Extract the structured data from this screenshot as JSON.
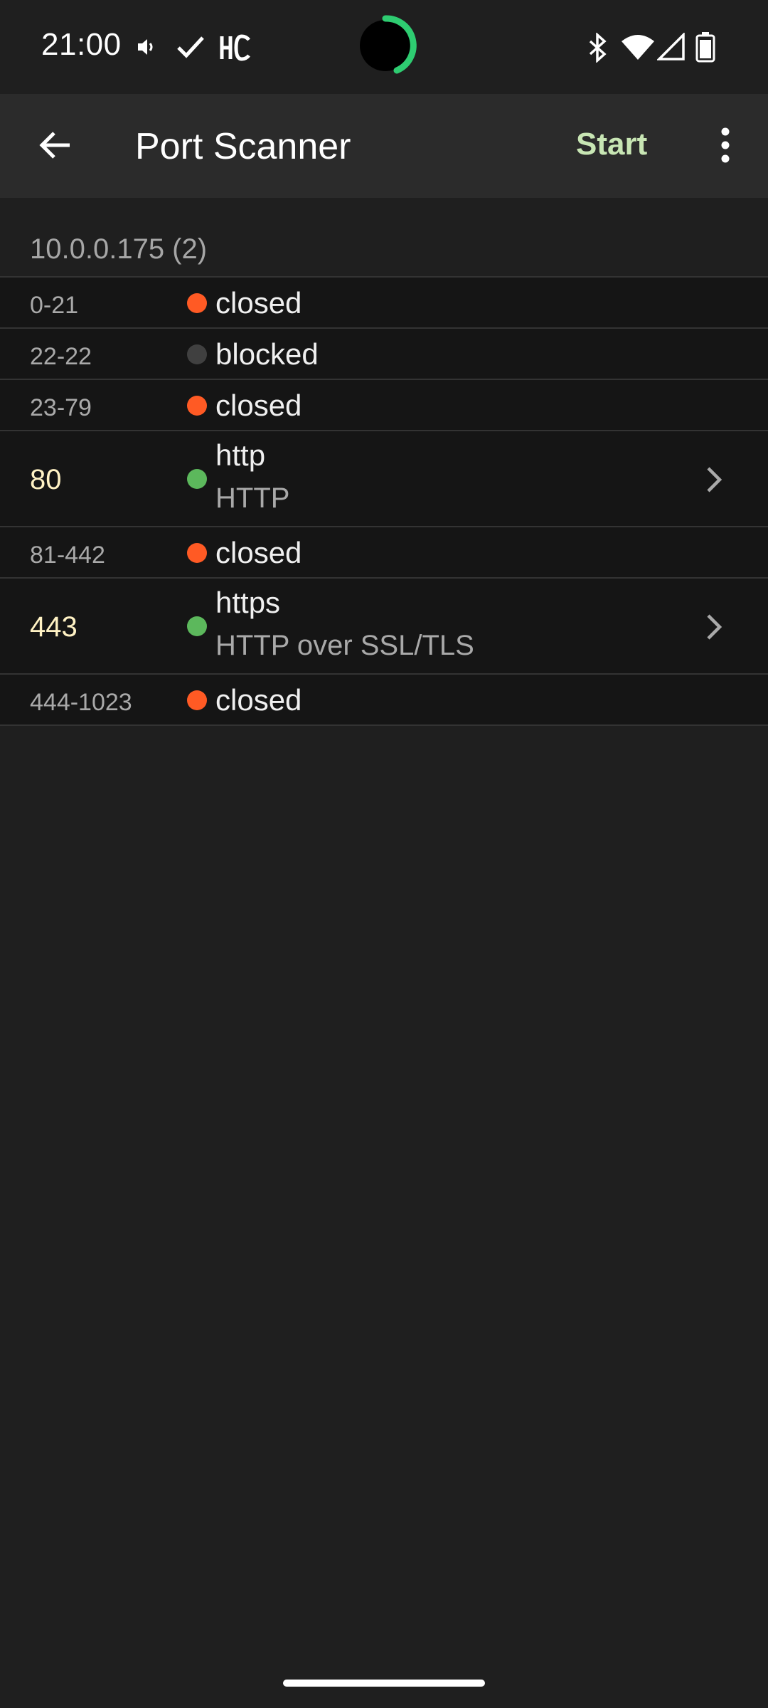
{
  "status_bar": {
    "time": "21:00",
    "icons": [
      "volume-icon",
      "check-icon",
      "hc-icon",
      "bluetooth-icon",
      "wifi-icon",
      "signal-icon",
      "battery-icon"
    ],
    "progress_ring_color": "#2ecc71"
  },
  "app_bar": {
    "title": "Port Scanner",
    "start_label": "Start",
    "start_color": "#c8e6b4",
    "back_icon": "arrow-back-icon",
    "menu_icon": "more-vert-icon"
  },
  "host": {
    "label": "10.0.0.175 (2)"
  },
  "status_colors": {
    "closed": "#ff5a24",
    "blocked": "#404040",
    "open": "#5cb85c"
  },
  "ports": [
    {
      "range": "0-21",
      "state": "closed",
      "status": "closed"
    },
    {
      "range": "22-22",
      "state": "blocked",
      "status": "blocked"
    },
    {
      "range": "23-79",
      "state": "closed",
      "status": "closed"
    },
    {
      "range": "80",
      "state": "http",
      "desc": "HTTP",
      "status": "open"
    },
    {
      "range": "81-442",
      "state": "closed",
      "status": "closed"
    },
    {
      "range": "443",
      "state": "https",
      "desc": "HTTP over SSL/TLS",
      "status": "open"
    },
    {
      "range": "444-1023",
      "state": "closed",
      "status": "closed"
    }
  ]
}
